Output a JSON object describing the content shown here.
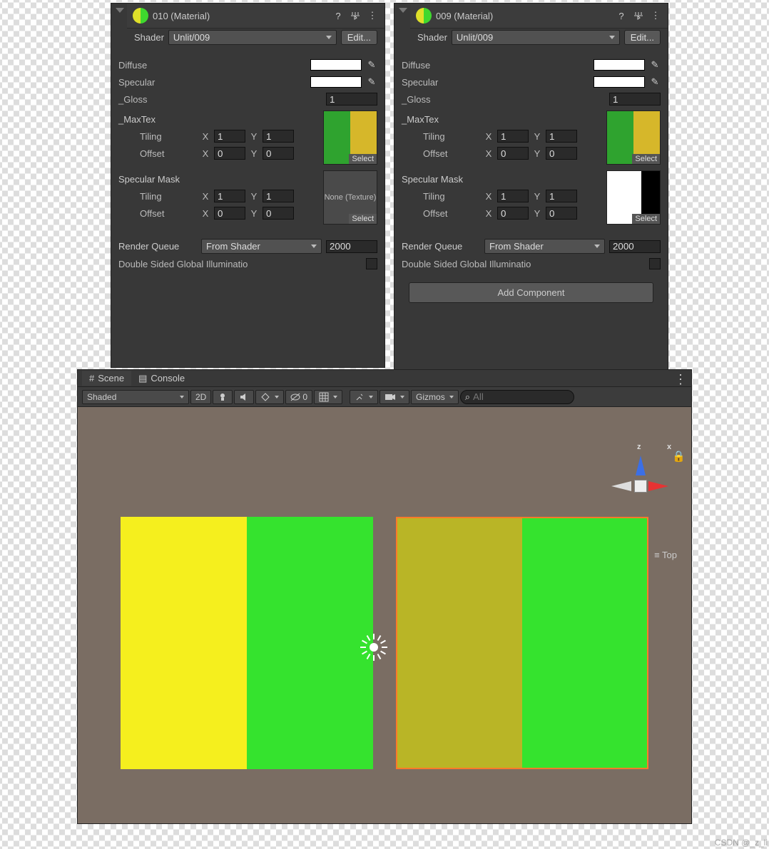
{
  "inspectorA": {
    "title": "010 (Material)",
    "shaderLabel": "Shader",
    "shaderValue": "Unlit/009",
    "editBtn": "Edit...",
    "diffuse": "Diffuse",
    "specular": "Specular",
    "gloss": "_Gloss",
    "glossVal": "1",
    "maxTex": "_MaxTex",
    "tiling": "Tiling",
    "offset": "Offset",
    "X": "X",
    "Y": "Y",
    "tx1": "1",
    "ty1": "1",
    "ox1": "0",
    "oy1": "0",
    "select": "Select",
    "specMask": "Specular Mask",
    "noneTex": "None (Texture)",
    "tx2": "1",
    "ty2": "1",
    "ox2": "0",
    "oy2": "0",
    "rq": "Render Queue",
    "rqMode": "From Shader",
    "rqVal": "2000",
    "dsgi": "Double Sided Global Illuminatio"
  },
  "inspectorB": {
    "title": "009 (Material)",
    "shaderLabel": "Shader",
    "shaderValue": "Unlit/009",
    "editBtn": "Edit...",
    "diffuse": "Diffuse",
    "specular": "Specular",
    "gloss": "_Gloss",
    "glossVal": "1",
    "maxTex": "_MaxTex",
    "tiling": "Tiling",
    "offset": "Offset",
    "X": "X",
    "Y": "Y",
    "tx1": "1",
    "ty1": "1",
    "ox1": "0",
    "oy1": "0",
    "select": "Select",
    "specMask": "Specular Mask",
    "tx2": "1",
    "ty2": "1",
    "ox2": "0",
    "oy2": "0",
    "rq": "Render Queue",
    "rqMode": "From Shader",
    "rqVal": "2000",
    "dsgi": "Double Sided Global Illuminatio",
    "addComp": "Add Component"
  },
  "scene": {
    "tabScene": "Scene",
    "tabConsole": "Console",
    "shadeMode": "Shaded",
    "btn2D": "2D",
    "hidden": "0",
    "gizmos": "Gizmos",
    "searchPlaceholder": "All",
    "axisZ": "z",
    "axisX": "x",
    "topLabel": "Top"
  },
  "watermark": "CSDN @_z_li"
}
